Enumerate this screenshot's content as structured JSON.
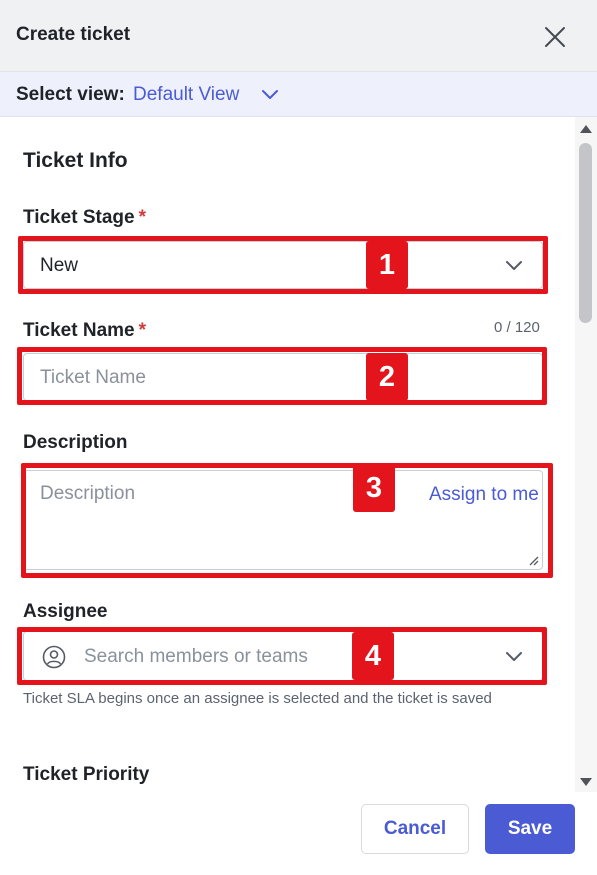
{
  "header": {
    "title": "Create ticket",
    "close_icon": "close-icon"
  },
  "view_selector": {
    "label": "Select view:",
    "value": "Default View"
  },
  "form": {
    "section_title": "Ticket Info",
    "ticket_stage": {
      "label": "Ticket Stage",
      "required_mark": "*",
      "value": "New"
    },
    "ticket_name": {
      "label": "Ticket Name",
      "required_mark": "*",
      "counter": "0 / 120",
      "placeholder": "Ticket Name"
    },
    "description": {
      "label": "Description",
      "placeholder": "Description"
    },
    "assignee": {
      "label": "Assignee",
      "assign_link": "Assign to me",
      "placeholder": "Search members or teams",
      "icon": "user-circle-icon",
      "help_text": "Ticket SLA begins once an assignee is selected and the ticket is saved"
    },
    "ticket_priority": {
      "label": "Ticket Priority"
    }
  },
  "annotations": [
    {
      "label": "1",
      "target": "ticket-stage-select"
    },
    {
      "label": "2",
      "target": "ticket-name-input"
    },
    {
      "label": "3",
      "target": "description-textarea"
    },
    {
      "label": "4",
      "target": "assignee-search"
    }
  ],
  "footer": {
    "cancel_label": "Cancel",
    "save_label": "Save"
  },
  "colors": {
    "accent": "#4a5bd4",
    "required": "#d23b3b",
    "highlight": "#e3141b",
    "header_bg": "#f0f1f3",
    "viewbar_bg": "#eef0fb"
  }
}
